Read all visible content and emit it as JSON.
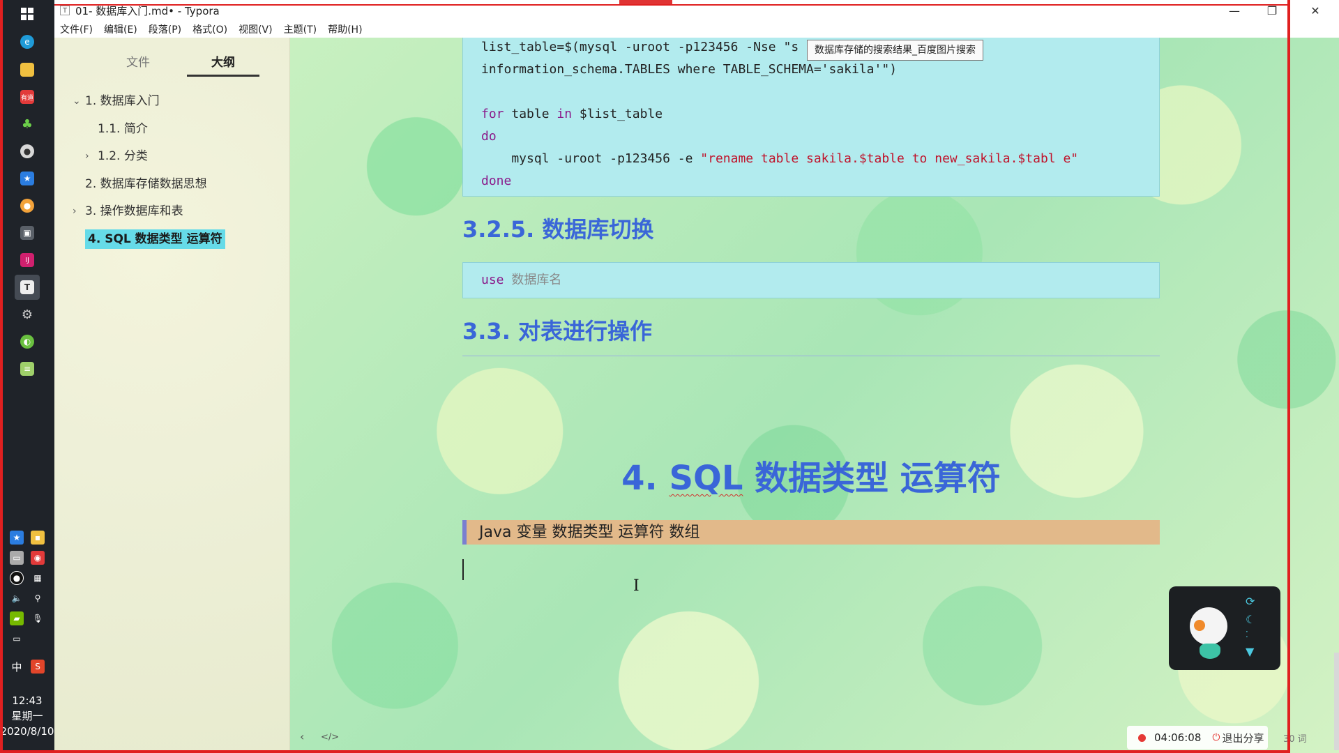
{
  "window": {
    "title": "01- 数据库入门.md• - Typora",
    "app_icon": "T",
    "controls": {
      "minimize": "—",
      "maximize": "❐",
      "close": "✕"
    }
  },
  "menu": [
    "文件(F)",
    "编辑(E)",
    "段落(P)",
    "格式(O)",
    "视图(V)",
    "主题(T)",
    "帮助(H)"
  ],
  "sidebar": {
    "tabs": [
      {
        "label": "文件",
        "active": false
      },
      {
        "label": "大纲",
        "active": true
      }
    ],
    "outline": [
      {
        "label": "1. 数据库入门",
        "expanded": true,
        "current": false
      },
      {
        "label": "1.1. 简介",
        "current": false
      },
      {
        "label": "1.2. 分类",
        "expanded": false,
        "current": false
      },
      {
        "label": "2. 数据库存储数据思想",
        "current": false
      },
      {
        "label": "3. 操作数据库和表",
        "expanded": false,
        "current": false
      },
      {
        "label": "4. SQL 数据类型 运算符",
        "current": true
      }
    ]
  },
  "editor": {
    "tooltip": "数据库存储的搜索结果_百度图片搜索",
    "code1": {
      "l1": "list_table=$(mysql -uroot -p123456 -Nse \"s",
      "l2": "information_schema.TABLES where TABLE_SCHEMA='sakila'\")",
      "l3_kw1": "for",
      "l3_var": " table ",
      "l3_kw2": "in",
      "l3_rest": " $list_table",
      "l4": "do",
      "l5_a": "    mysql -uroot -p123456 -e ",
      "l5_str": "\"rename table sakila.$table to new_sakila.$tabl e\"",
      "l6": "done"
    },
    "h_325": "3.2.5. 数据库切换",
    "code2": {
      "kw": "use",
      "rest": " 数据库名"
    },
    "h_33": "3.3. 对表进行操作",
    "h1_prefix": "4. ",
    "h1_sql": "SQL",
    "h1_rest": " 数据类型 运算符",
    "blockquote": "Java 变量 数据类型 运算符 数组"
  },
  "status": {
    "record_time": "04:06:08",
    "exit_share": "退出分享",
    "word_count": "30 词",
    "nav_back": "‹",
    "nav_source": "</>"
  },
  "taskbar": {
    "clock_time": "12:43",
    "clock_day": "星期一",
    "clock_date": "2020/8/10",
    "ime": "中"
  },
  "colors": {
    "heading": "#3a66d8",
    "code_bg": "#b2ebee",
    "outline_highlight": "#66dbe8",
    "blockquote_bg": "#e2b98a",
    "record_red": "#e53935"
  }
}
